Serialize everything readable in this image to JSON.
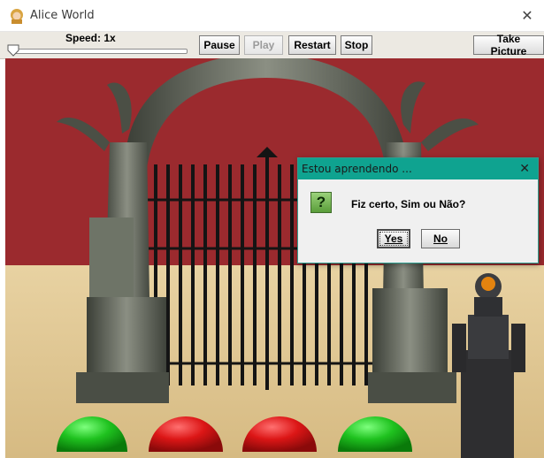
{
  "window": {
    "title": "Alice World",
    "close_glyph": "✕"
  },
  "toolbar": {
    "speed_label": "Speed: 1x",
    "pause_label": "Pause",
    "play_label": "Play",
    "restart_label": "Restart",
    "stop_label": "Stop",
    "take_picture_label": "Take Picture"
  },
  "dialog": {
    "title": "Estou aprendendo ...",
    "close_glyph": "✕",
    "icon_glyph": "?",
    "message": "Fiz certo, Sim ou Não?",
    "yes_label": "Yes",
    "no_label": "No"
  },
  "scene": {
    "wall_color": "#9b2a2e",
    "floor_color": "#dfc592",
    "dome_colors": [
      "#1fb81f",
      "#d41818",
      "#d41818",
      "#1fb81f"
    ]
  }
}
